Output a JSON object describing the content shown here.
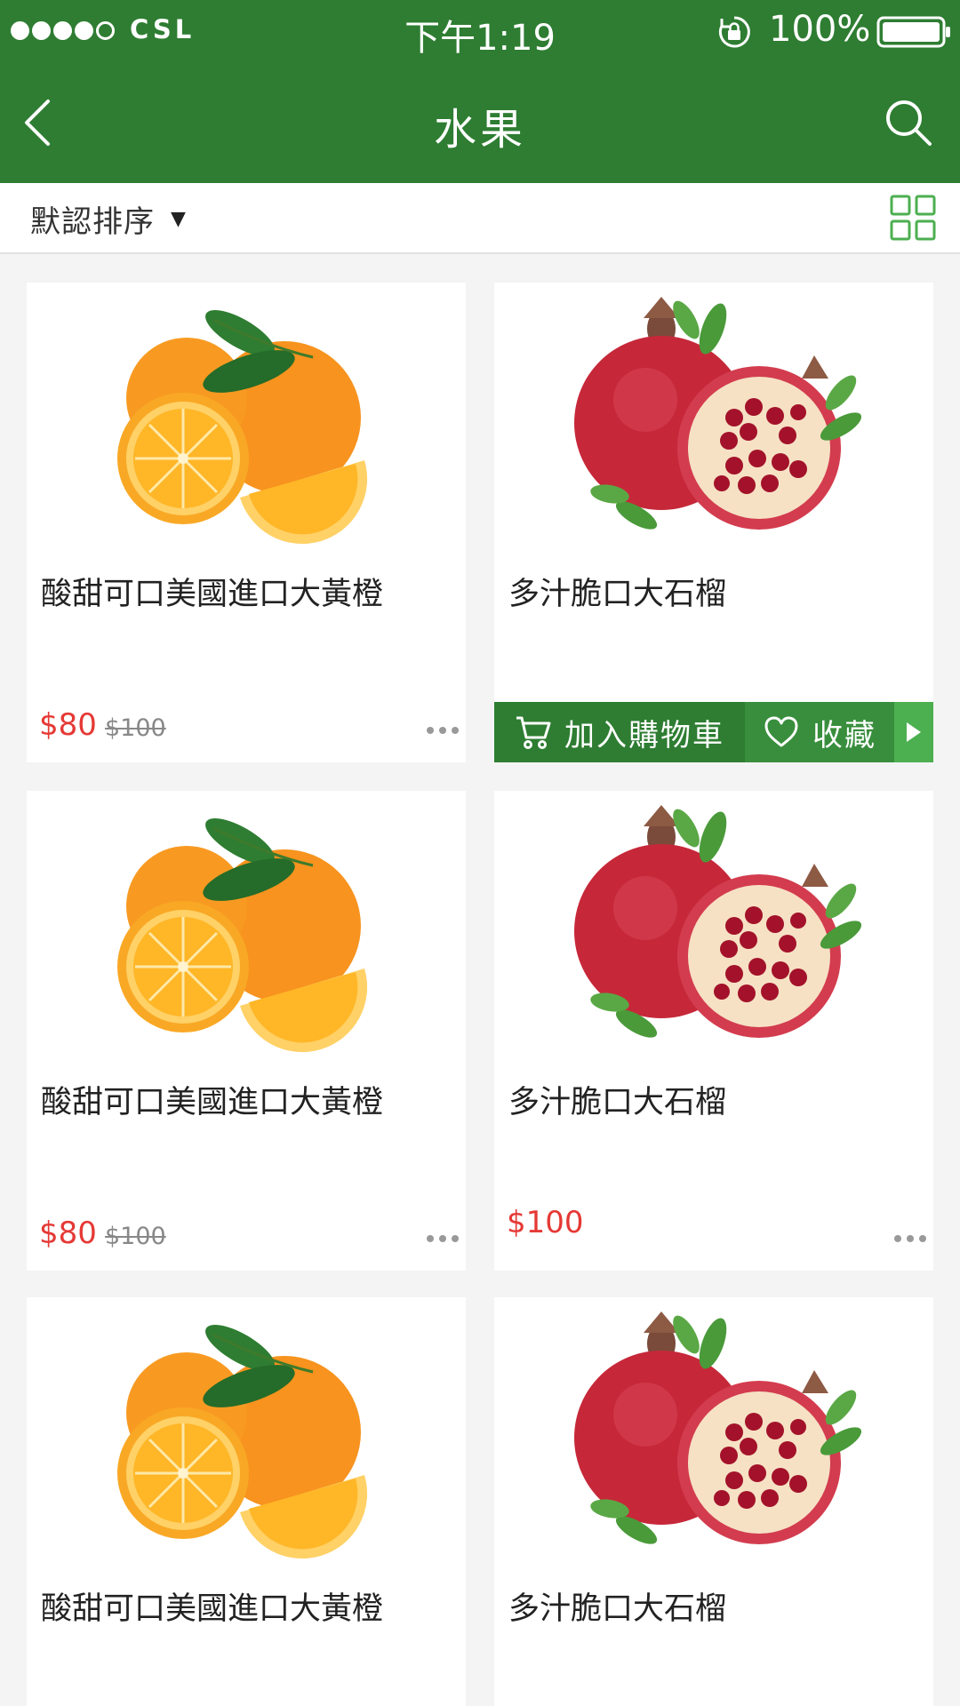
{
  "status_bar": {
    "carrier": "CSL",
    "time": "下午1:19",
    "battery": "100%",
    "signal_bars": 4
  },
  "nav": {
    "title": "水果",
    "back_icon": "chevron-left-icon",
    "search_icon": "search-icon"
  },
  "sort": {
    "label": "默認排序",
    "caret": "▼",
    "view_icon": "grid-view-icon"
  },
  "colors": {
    "primary": "#2e7d32",
    "price": "#e53935",
    "action_light": "#4caf50"
  },
  "products": [
    {
      "name": "酸甜可口美國進口大黃橙",
      "price": "$80",
      "original_price": "$100",
      "image": "orange"
    },
    {
      "name": "多汁脆口大石榴",
      "image": "pomegranate",
      "actions": {
        "cart": "加入購物車",
        "favorite": "收藏"
      }
    },
    {
      "name": "酸甜可口美國進口大黃橙",
      "price": "$80",
      "original_price": "$100",
      "image": "orange"
    },
    {
      "name": "多汁脆口大石榴",
      "price": "$100",
      "image": "pomegranate"
    },
    {
      "name": "酸甜可口美國進口大黃橙",
      "image": "orange"
    },
    {
      "name": "多汁脆口大石榴",
      "image": "pomegranate"
    }
  ]
}
